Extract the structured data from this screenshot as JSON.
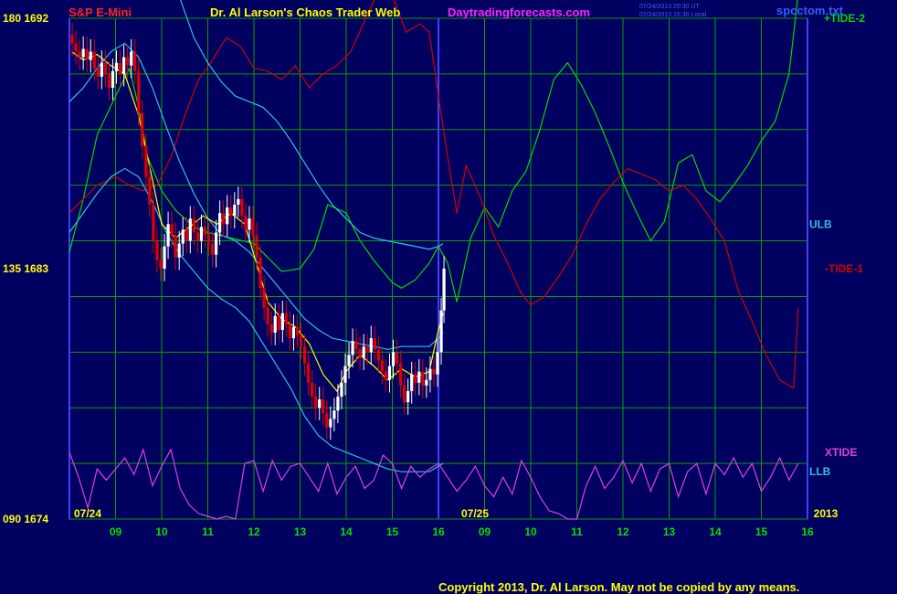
{
  "header": {
    "instrument": "S&P E-Mini",
    "title": "Dr. Al Larson's Chaos Trader Web",
    "site": "Daytradingforecasts.com",
    "timestamp_ut": "07/24/2013 20:30 UT",
    "timestamp_local": "07/24/2013 15:30 Local",
    "datafile": "spcctom.txt"
  },
  "footer": {
    "copyright": "Copyright 2013, Dr. Al Larson. May not be copied by any means."
  },
  "colors": {
    "background": "#000060",
    "grid": "#00a000",
    "price_up": "#ffffff",
    "price_down": "#e00000",
    "moving_average": "#ffff00",
    "tide_plus2": "#00d800",
    "tide_minus1": "#d00000",
    "ulb": "#30c0e0",
    "llb": "#30c0e0",
    "xtide": "#e040e0",
    "day_divider": "#4040ff"
  },
  "chart_data": {
    "type": "line",
    "title": "S&P E-Mini",
    "y_labels": [
      {
        "value": 1692,
        "text": "180  1692"
      },
      {
        "value": 1683,
        "text": "135  1683"
      },
      {
        "value": 1674,
        "text": "090  1674"
      }
    ],
    "ylim": [
      1674,
      1692
    ],
    "x_ticks": [
      "09",
      "10",
      "11",
      "12",
      "13",
      "14",
      "15",
      "16",
      "09",
      "10",
      "11",
      "12",
      "13",
      "14",
      "15",
      "16"
    ],
    "date_labels": [
      "07/24",
      "07/25",
      "2013"
    ],
    "grid": true,
    "series_labels": [
      "+TIDE-2",
      "ULB",
      "-TIDE-1",
      "XTIDE",
      "LLB"
    ],
    "series": [
      {
        "name": "+TIDE-2",
        "color": "#00d800",
        "x": [
          8.0,
          8.3,
          8.6,
          9.0,
          9.3,
          9.5,
          9.7,
          10.0,
          10.3,
          10.7,
          11.0,
          11.5,
          12.0,
          12.3,
          12.6,
          13.0,
          13.3,
          13.6,
          14.0,
          14.3,
          14.6,
          15.0,
          15.2,
          15.5,
          15.8,
          16.0,
          16.2,
          16.4,
          16.7,
          17.0,
          17.3,
          17.6,
          17.9,
          18.2,
          18.5,
          18.8,
          19.1,
          19.4,
          19.7,
          20.0,
          20.3,
          20.6,
          20.9,
          21.2,
          21.5,
          21.8,
          22.1,
          22.4,
          22.7,
          23.0,
          23.3,
          23.6,
          23.8
        ],
        "y": [
          1683.6,
          1685.5,
          1687.8,
          1689.2,
          1690.2,
          1688.8,
          1687.0,
          1685.8,
          1685.1,
          1684.5,
          1684.3,
          1684.1,
          1683.9,
          1683.4,
          1682.9,
          1683.0,
          1683.7,
          1685.3,
          1685.0,
          1684.0,
          1683.3,
          1682.5,
          1682.3,
          1682.6,
          1683.2,
          1683.8,
          1683.2,
          1681.8,
          1684.1,
          1685.2,
          1684.5,
          1685.8,
          1686.5,
          1688.0,
          1689.8,
          1690.4,
          1689.6,
          1688.6,
          1687.4,
          1686.1,
          1685.0,
          1684.0,
          1684.7,
          1686.8,
          1687.1,
          1685.8,
          1685.4,
          1686.0,
          1686.7,
          1687.6,
          1688.3,
          1690.0,
          1692.9
        ]
      },
      {
        "name": "-TIDE-1",
        "color": "#d00000",
        "x": [
          8.0,
          8.3,
          8.6,
          9.0,
          9.3,
          9.6,
          9.9,
          10.2,
          10.5,
          10.8,
          11.1,
          11.4,
          11.7,
          12.0,
          12.3,
          12.6,
          12.9,
          13.2,
          13.5,
          13.8,
          14.1,
          14.4,
          14.7,
          15.0,
          15.3,
          15.6,
          15.8,
          16.0,
          16.2,
          16.4,
          16.6,
          16.9,
          17.2,
          17.5,
          17.8,
          18.0,
          18.3,
          18.6,
          18.9,
          19.2,
          19.5,
          19.8,
          20.1,
          20.4,
          20.7,
          21.0,
          21.3,
          21.6,
          21.9,
          22.2,
          22.5,
          22.8,
          23.1,
          23.4,
          23.7,
          23.8
        ],
        "y": [
          1685.0,
          1685.5,
          1686.0,
          1686.3,
          1686.0,
          1685.8,
          1686.0,
          1687.0,
          1688.5,
          1689.8,
          1690.5,
          1691.3,
          1691.0,
          1690.2,
          1690.1,
          1689.8,
          1690.3,
          1689.5,
          1690.0,
          1690.3,
          1690.8,
          1691.9,
          1693.0,
          1692.8,
          1691.5,
          1691.8,
          1691.5,
          1689.2,
          1687.0,
          1685.0,
          1686.7,
          1685.6,
          1684.2,
          1683.2,
          1682.1,
          1681.7,
          1682.0,
          1682.7,
          1683.5,
          1684.6,
          1685.5,
          1686.1,
          1686.6,
          1686.4,
          1686.2,
          1685.8,
          1686.0,
          1685.5,
          1684.8,
          1684.0,
          1682.2,
          1681.1,
          1679.9,
          1679.0,
          1678.7,
          1681.6
        ]
      },
      {
        "name": "ULB",
        "color": "#30c0e0",
        "x": [
          8.0,
          8.3,
          8.6,
          8.9,
          9.2,
          9.5,
          9.8,
          10.1,
          10.4,
          10.7,
          11.0,
          11.3,
          11.6,
          11.9,
          12.2,
          12.5,
          12.8,
          13.1,
          13.4,
          13.7,
          14.0,
          14.3,
          14.6,
          14.9,
          15.2,
          15.5,
          15.8,
          16.0,
          16.1
        ],
        "y": [
          1694.0,
          1694.5,
          1695.0,
          1695.3,
          1695.6,
          1695.8,
          1695.2,
          1694.0,
          1692.7,
          1691.3,
          1690.4,
          1689.7,
          1689.2,
          1689.0,
          1688.8,
          1688.3,
          1687.6,
          1686.8,
          1686.0,
          1685.3,
          1684.8,
          1684.3,
          1684.1,
          1684.0,
          1683.9,
          1683.8,
          1683.7,
          1683.8,
          1683.9
        ]
      },
      {
        "name": "Mid band",
        "color": "#30c0e0",
        "x": [
          8.0,
          8.3,
          8.6,
          8.9,
          9.2,
          9.5,
          9.8,
          10.1,
          10.4,
          10.7,
          11.0,
          11.3,
          11.6,
          11.9,
          12.2,
          12.5,
          12.8,
          13.1,
          13.4,
          13.7,
          14.0,
          14.3,
          14.6,
          14.9,
          15.2,
          15.5,
          15.8,
          16.0,
          16.1
        ],
        "y": [
          1689.0,
          1689.5,
          1690.2,
          1690.8,
          1691.1,
          1690.6,
          1689.5,
          1688.1,
          1686.8,
          1685.7,
          1684.8,
          1684.2,
          1684.0,
          1683.6,
          1683.0,
          1682.4,
          1681.8,
          1681.2,
          1680.8,
          1680.5,
          1680.4,
          1680.3,
          1680.2,
          1680.1,
          1680.2,
          1680.2,
          1680.2,
          1680.5,
          1680.7
        ]
      },
      {
        "name": "LLB",
        "color": "#30c0e0",
        "x": [
          8.0,
          8.3,
          8.6,
          8.9,
          9.2,
          9.5,
          9.8,
          10.1,
          10.4,
          10.7,
          11.0,
          11.3,
          11.6,
          11.9,
          12.2,
          12.5,
          12.8,
          13.1,
          13.4,
          13.7,
          14.0,
          14.3,
          14.6,
          14.9,
          15.2,
          15.5,
          15.8,
          16.0,
          16.1
        ],
        "y": [
          1684.3,
          1685.0,
          1685.7,
          1686.3,
          1686.6,
          1686.3,
          1685.4,
          1684.3,
          1683.5,
          1682.9,
          1682.3,
          1681.9,
          1681.6,
          1681.1,
          1680.3,
          1679.5,
          1678.7,
          1677.7,
          1677.0,
          1676.6,
          1676.4,
          1676.2,
          1676.0,
          1675.8,
          1675.7,
          1675.7,
          1675.7,
          1675.9,
          1676.0
        ]
      },
      {
        "name": "Moving average",
        "color": "#ffff00",
        "x": [
          8.05,
          8.3,
          8.6,
          8.9,
          9.2,
          9.5,
          9.8,
          10.0,
          10.3,
          10.6,
          10.9,
          11.2,
          11.5,
          11.8,
          12.0,
          12.3,
          12.6,
          12.9,
          13.2,
          13.5,
          13.8,
          14.0,
          14.3,
          14.6,
          14.9,
          15.2,
          15.5,
          15.8,
          16.0,
          16.1
        ],
        "y": [
          1690.8,
          1690.5,
          1690.7,
          1690.3,
          1690.0,
          1688.5,
          1686.2,
          1684.6,
          1684.1,
          1684.5,
          1684.9,
          1684.6,
          1685.0,
          1684.6,
          1683.5,
          1681.8,
          1681.2,
          1680.9,
          1680.3,
          1679.2,
          1678.6,
          1679.3,
          1679.9,
          1679.5,
          1679.0,
          1679.4,
          1679.1,
          1679.3,
          1680.8,
          1681.4
        ]
      },
      {
        "name": "XTIDE",
        "color": "#e040e0",
        "x": [
          8.0,
          8.2,
          8.4,
          8.6,
          8.8,
          9.0,
          9.2,
          9.4,
          9.6,
          9.8,
          10.0,
          10.2,
          10.4,
          10.6,
          10.8,
          11.0,
          11.2,
          11.4,
          11.6,
          11.8,
          12.0,
          12.2,
          12.4,
          12.6,
          12.8,
          13.0,
          13.2,
          13.4,
          13.6,
          13.8,
          14.0,
          14.2,
          14.4,
          14.6,
          14.8,
          15.0,
          15.2,
          15.4,
          15.6,
          15.8,
          16.0,
          16.2,
          16.4,
          16.6,
          16.8,
          17.0,
          17.2,
          17.4,
          17.6,
          17.8,
          18.0,
          18.2,
          18.4,
          18.6,
          18.8,
          19.0,
          19.2,
          19.4,
          19.6,
          19.8,
          20.0,
          20.2,
          20.4,
          20.6,
          20.8,
          21.0,
          21.2,
          21.4,
          21.6,
          21.8,
          22.0,
          22.2,
          22.4,
          22.6,
          22.8,
          23.0,
          23.2,
          23.4,
          23.6,
          23.8
        ],
        "y": [
          1676.4,
          1675.5,
          1674.4,
          1675.8,
          1675.4,
          1675.8,
          1676.2,
          1675.6,
          1676.5,
          1675.2,
          1675.9,
          1676.5,
          1675.1,
          1674.5,
          1674.2,
          1674.1,
          1674.0,
          1674.1,
          1674.0,
          1676.0,
          1676.1,
          1675.0,
          1676.1,
          1675.4,
          1675.9,
          1676.0,
          1675.5,
          1675.0,
          1676.0,
          1674.9,
          1675.5,
          1675.9,
          1675.1,
          1675.4,
          1676.3,
          1676.0,
          1675.1,
          1675.9,
          1675.5,
          1675.8,
          1676.0,
          1675.5,
          1675.0,
          1675.4,
          1675.9,
          1675.2,
          1674.8,
          1675.5,
          1674.9,
          1676.1,
          1675.5,
          1674.8,
          1674.3,
          1674.2,
          1674.0,
          1674.0,
          1675.2,
          1675.9,
          1675.1,
          1675.5,
          1676.1,
          1675.3,
          1676.0,
          1675.0,
          1675.8,
          1676.0,
          1674.8,
          1675.7,
          1676.0,
          1674.9,
          1676.0,
          1675.6,
          1676.2,
          1675.5,
          1676.0,
          1675.0,
          1675.5,
          1676.2,
          1675.4,
          1676.0
        ]
      }
    ],
    "price_bars": {
      "color_rule": "white when close rises, red when close falls",
      "time": [
        8.06,
        8.14,
        8.22,
        8.3,
        8.38,
        8.46,
        8.54,
        8.62,
        8.7,
        8.78,
        8.86,
        8.94,
        9.02,
        9.1,
        9.18,
        9.26,
        9.34,
        9.42,
        9.5,
        9.58,
        9.66,
        9.74,
        9.82,
        9.9,
        9.98,
        10.06,
        10.14,
        10.22,
        10.3,
        10.38,
        10.46,
        10.54,
        10.62,
        10.7,
        10.78,
        10.86,
        10.94,
        11.02,
        11.1,
        11.18,
        11.26,
        11.34,
        11.42,
        11.5,
        11.58,
        11.66,
        11.74,
        11.82,
        11.9,
        11.98,
        12.06,
        12.14,
        12.22,
        12.3,
        12.38,
        12.46,
        12.54,
        12.62,
        12.7,
        12.78,
        12.86,
        12.94,
        13.02,
        13.1,
        13.18,
        13.26,
        13.34,
        13.42,
        13.5,
        13.58,
        13.66,
        13.74,
        13.82,
        13.9,
        13.98,
        14.06,
        14.14,
        14.22,
        14.3,
        14.38,
        14.46,
        14.54,
        14.62,
        14.7,
        14.78,
        14.86,
        14.94,
        15.02,
        15.1,
        15.18,
        15.26,
        15.34,
        15.42,
        15.5,
        15.58,
        15.66,
        15.74,
        15.82,
        15.9,
        15.98,
        16.06,
        16.12
      ],
      "close": [
        1691.1,
        1690.8,
        1690.6,
        1690.9,
        1690.5,
        1690.8,
        1690.2,
        1689.9,
        1690.4,
        1690.0,
        1689.5,
        1690.1,
        1690.4,
        1690.0,
        1690.6,
        1690.3,
        1690.8,
        1690.1,
        1688.6,
        1687.4,
        1686.3,
        1685.3,
        1684.0,
        1683.3,
        1683.0,
        1683.8,
        1684.6,
        1684.2,
        1683.4,
        1683.9,
        1684.4,
        1684.0,
        1684.8,
        1684.3,
        1684.0,
        1684.5,
        1684.2,
        1683.9,
        1683.5,
        1684.3,
        1685.0,
        1684.6,
        1685.2,
        1684.9,
        1685.3,
        1685.5,
        1684.9,
        1684.4,
        1684.8,
        1684.2,
        1683.4,
        1682.3,
        1681.6,
        1681.0,
        1680.7,
        1681.3,
        1680.8,
        1681.4,
        1681.0,
        1680.5,
        1680.9,
        1680.6,
        1680.2,
        1679.6,
        1678.9,
        1678.4,
        1678.0,
        1678.3,
        1677.8,
        1677.3,
        1677.6,
        1677.9,
        1678.4,
        1678.9,
        1679.5,
        1679.9,
        1680.4,
        1680.1,
        1679.8,
        1680.2,
        1680.0,
        1680.5,
        1680.1,
        1679.7,
        1679.3,
        1679.0,
        1679.5,
        1680.0,
        1679.6,
        1678.8,
        1678.2,
        1678.6,
        1679.2,
        1678.9,
        1679.3,
        1678.8,
        1679.0,
        1679.4,
        1679.2,
        1680.0,
        1681.5,
        1683.0
      ]
    }
  }
}
